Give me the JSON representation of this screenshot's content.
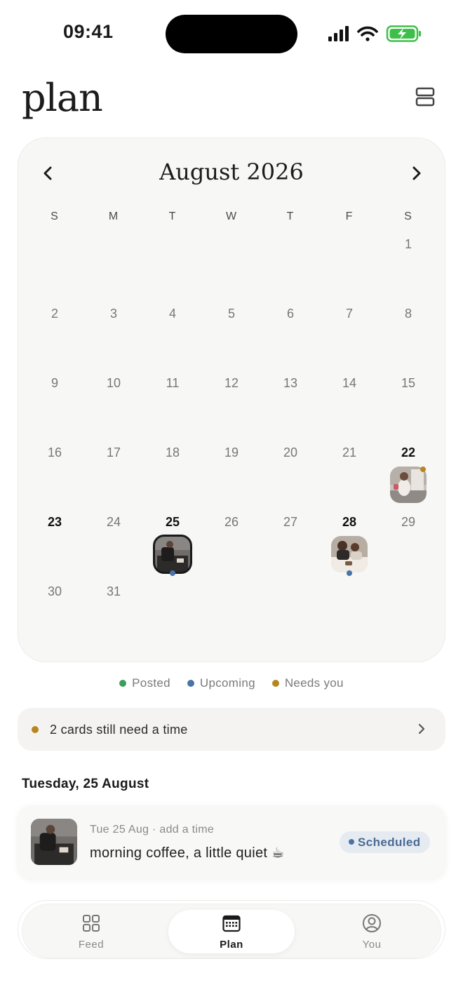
{
  "status_bar": {
    "time": "09:41"
  },
  "header": {
    "title": "plan",
    "view_toggle_icon": "layout-stack-icon"
  },
  "calendar": {
    "month_label": "August 2026",
    "weekdays": [
      "S",
      "M",
      "T",
      "W",
      "T",
      "F",
      "S"
    ],
    "days": [
      "1",
      "2",
      "3",
      "4",
      "5",
      "6",
      "7",
      "8",
      "9",
      "10",
      "11",
      "12",
      "13",
      "14",
      "15",
      "16",
      "17",
      "18",
      "19",
      "20",
      "21",
      "22",
      "23",
      "24",
      "25",
      "26",
      "27",
      "28",
      "29",
      "30",
      "31"
    ],
    "bold_days": [
      "22",
      "23",
      "25",
      "28"
    ],
    "scheduled_posts": [
      {
        "day": "22",
        "status": "needs_you",
        "selected": false
      },
      {
        "day": "25",
        "status": "upcoming",
        "selected": true
      },
      {
        "day": "28",
        "status": "upcoming",
        "selected": false
      }
    ]
  },
  "legend": {
    "posted": {
      "label": "Posted",
      "color": "#3f9d5c"
    },
    "upcoming": {
      "label": "Upcoming",
      "color": "#4a74a8"
    },
    "needs_you": {
      "label": "Needs you",
      "color": "#b8861f"
    }
  },
  "banner": {
    "text": "2 cards still need a time",
    "dot_color": "#b8861f"
  },
  "selected_day": {
    "heading": "Tuesday, 25 August",
    "post": {
      "meta": "Tue 25 Aug · add a time",
      "caption": "morning coffee, a little quiet ☕",
      "status_label": "Scheduled",
      "status_color": "#4a74a8"
    }
  },
  "tabs": [
    {
      "label": "Feed",
      "icon": "grid-icon",
      "active": false
    },
    {
      "label": "Plan",
      "icon": "calendar-icon",
      "active": true
    },
    {
      "label": "You",
      "icon": "profile-icon",
      "active": false
    }
  ]
}
